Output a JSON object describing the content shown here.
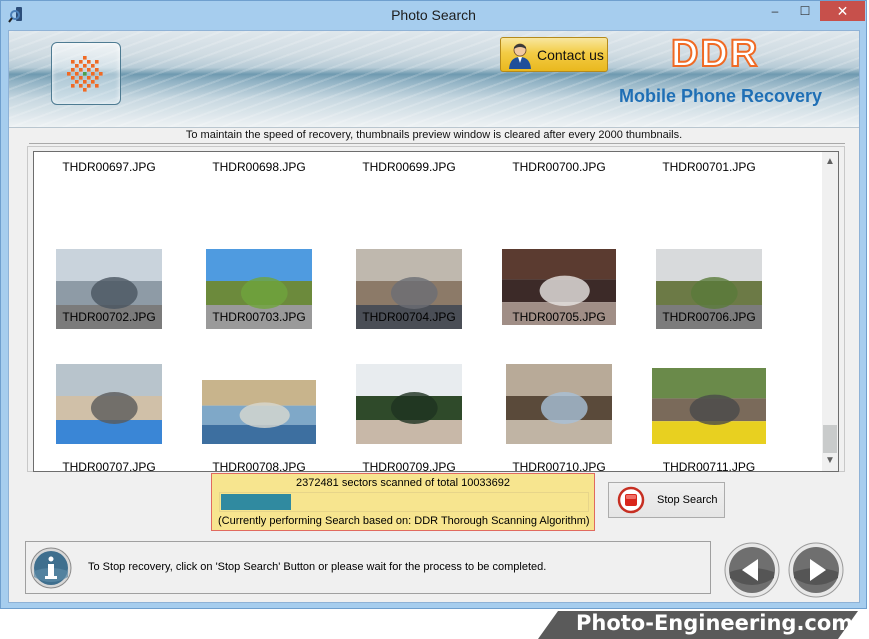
{
  "window": {
    "title": "Photo Search",
    "controls": {
      "minimize": "–",
      "maximize": "☐",
      "close": "✕"
    }
  },
  "banner": {
    "contact_label": "Contact us",
    "brand": "DDR",
    "product": "Mobile Phone Recovery"
  },
  "notice": "To maintain the speed of recovery, thumbnails preview window is cleared after every 2000 thumbnails.",
  "thumbnails": {
    "rows": [
      {
        "images": false,
        "items": [
          {
            "name": "THDR00697.JPG"
          },
          {
            "name": "THDR00698.JPG"
          },
          {
            "name": "THDR00699.JPG"
          },
          {
            "name": "THDR00700.JPG"
          },
          {
            "name": "THDR00701.JPG"
          }
        ]
      },
      {
        "images": true,
        "items": [
          {
            "name": "THDR00702.JPG",
            "scene": "bridge-cyclists"
          },
          {
            "name": "THDR00703.JPG",
            "scene": "parking-lot-trees"
          },
          {
            "name": "THDR00704.JPG",
            "scene": "storefront"
          },
          {
            "name": "THDR00705.JPG",
            "scene": "party-group"
          },
          {
            "name": "THDR00706.JPG",
            "scene": "country-road"
          }
        ]
      },
      {
        "images": true,
        "items": [
          {
            "name": "THDR00707.JPG",
            "scene": "conference-group"
          },
          {
            "name": "THDR00708.JPG",
            "scene": "boat-ride"
          },
          {
            "name": "THDR00709.JPG",
            "scene": "hillside-hotel"
          },
          {
            "name": "THDR00710.JPG",
            "scene": "staircase-group"
          },
          {
            "name": "THDR00711.JPG",
            "scene": "motocross"
          }
        ]
      }
    ]
  },
  "scan": {
    "status": "2372481 sectors scanned of total 10033692",
    "progress_percent": 19,
    "algorithm": "(Currently performing Search based on:  DDR Thorough Scanning Algorithm)"
  },
  "stop_button": {
    "label": "Stop Search",
    "icon": "stop-icon"
  },
  "info": {
    "icon": "info-icon",
    "text": "To Stop recovery, click on 'Stop Search' Button or please wait for the process to be completed."
  },
  "nav": {
    "back_icon": "back-arrow-icon",
    "next_icon": "next-arrow-icon"
  },
  "footer_brand": "Photo-Engineering.com",
  "colors": {
    "accent": "#1f6fb5",
    "ddr_orange": "#f06a24",
    "progress": "#308aa0",
    "status_bg": "#f7e58f",
    "close_red": "#c7504b"
  }
}
